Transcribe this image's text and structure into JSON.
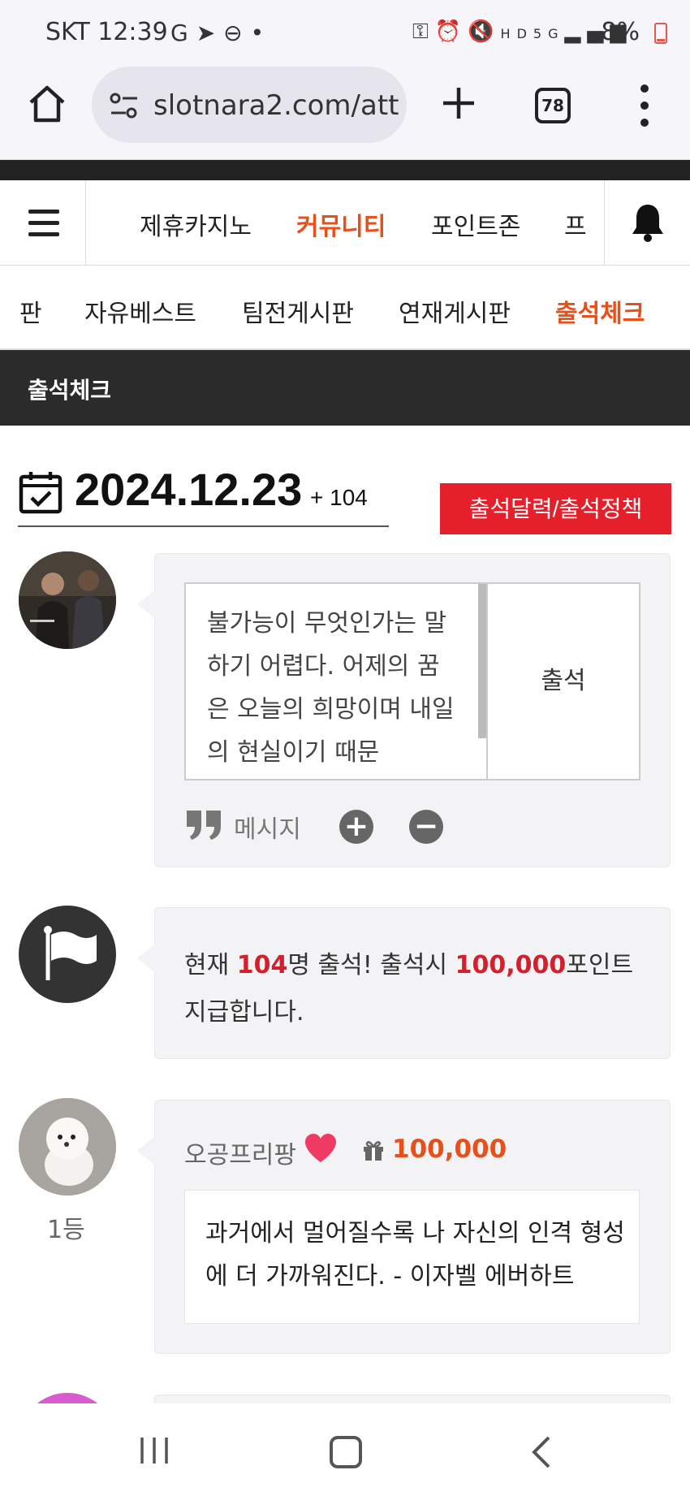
{
  "status_bar": {
    "carrier_time": "SKT 12:39",
    "battery": "8%",
    "left_icons": [
      "google-icon",
      "telegram-icon",
      "dnd-icon",
      "dot-icon"
    ],
    "right_icons": [
      "key-icon",
      "alarm-icon",
      "mute-icon",
      "hd-voice-icon",
      "5g-icon",
      "signal-icon",
      "battery-icon"
    ]
  },
  "browser": {
    "url": "slotnara2.com/att",
    "tab_count": "78"
  },
  "main_nav": {
    "items": [
      "제휴카지노",
      "커뮤니티",
      "포인트존",
      "프"
    ],
    "active": "커뮤니티"
  },
  "sub_nav": {
    "items": [
      "판",
      "자유베스트",
      "팀전게시판",
      "연재게시판",
      "출석체크"
    ],
    "active": "출석체크"
  },
  "section_title": "출석체크",
  "date_row": {
    "date": "2024.12.23",
    "count": "+ 104",
    "policy_button": "출석달력/출석정책"
  },
  "attend_box": {
    "message": "불가능이 무엇인가는 말하기 어렵다. 어제의 꿈은 오늘의 희망이며 내일의 현실이기 때문",
    "attend_button": "출석",
    "message_label": "메시지"
  },
  "info": {
    "prefix": "현재 ",
    "count": "104",
    "mid": "명 출석! 출석시 ",
    "points": "100,000",
    "suffix": "포인트",
    "line2": "지급합니다."
  },
  "entries": [
    {
      "name": "오공프리팡",
      "points": "100,000",
      "rank": "1등",
      "message": "과거에서 멀어질수록 나 자신의 인격 형성에 더 가까워진다. - 이자벨 에버하트"
    }
  ],
  "colors": {
    "accent_orange": "#e8501a",
    "accent_red": "#e5202a",
    "dark_header": "#2b2b2b"
  }
}
